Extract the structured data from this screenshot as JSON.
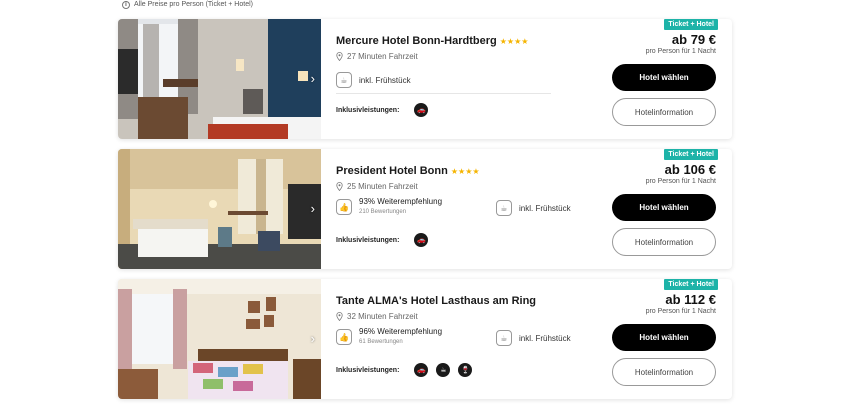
{
  "notice": {
    "text": "Alle Preise pro Person (Ticket + Hotel)"
  },
  "labels": {
    "inclusive": "Inklusivleistungen:",
    "select_button": "Hotel wählen",
    "info_button": "Hotelinformation",
    "per_person": "pro Person für 1 Nacht",
    "badge": "Ticket + Hotel",
    "breakfast": "inkl. Frühstück"
  },
  "hotels": [
    {
      "name": "Mercure Hotel Bonn-Hardtberg",
      "stars": "★★★★",
      "distance": "27 Minuten Fahrzeit",
      "price": "ab 79 €",
      "inclusive_icons": [
        "car-icon"
      ]
    },
    {
      "name": "President Hotel Bonn",
      "stars": "★★★★",
      "distance": "25 Minuten Fahrzeit",
      "recommendation": "93% Weiterempfehlung",
      "reviews": "210 Bewertungen",
      "price": "ab 106 €",
      "inclusive_icons": [
        "car-icon"
      ]
    },
    {
      "name": "Tante ALMA's Hotel Lasthaus am Ring",
      "distance": "32 Minuten Fahrzeit",
      "recommendation": "96% Weiterempfehlung",
      "reviews": "61 Bewertungen",
      "price": "ab 112 €",
      "inclusive_icons": [
        "car-icon",
        "coffee-machine-icon",
        "wine-glass-icon"
      ]
    }
  ],
  "colors": {
    "badge": "#1db3a8",
    "stars": "#f5b400",
    "primary_button": "#000000"
  }
}
